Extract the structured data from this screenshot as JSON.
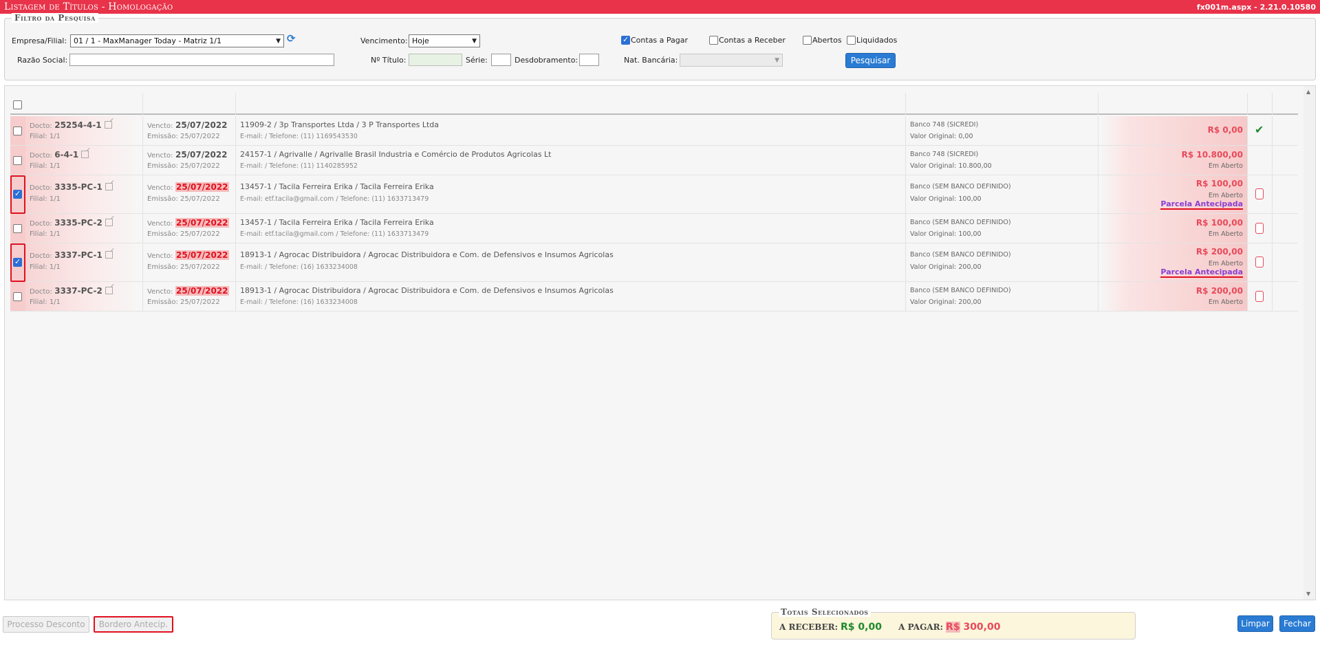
{
  "window": {
    "title": "Listagem de Títulos  - Homologação",
    "version": "fx001m.aspx - 2.21.0.10580"
  },
  "filter": {
    "legend": "Filtro da Pesquisa",
    "empresa_label": "Empresa/Filial:",
    "empresa_value": "01 / 1 - MaxManager Today - Matriz 1/1",
    "vencimento_label": "Vencimento:",
    "vencimento_value": "Hoje",
    "contas_pagar_label": "Contas a Pagar",
    "contas_pagar_checked": true,
    "contas_receber_label": "Contas a Receber",
    "abertos_label": "Abertos",
    "liquidados_label": "Liquidados",
    "razao_label": "Razão Social:",
    "titulo_label": "Nº Título:",
    "serie_label": "Série:",
    "desdobramento_label": "Desdobramento:",
    "nat_bancaria_label": "Nat. Bancária:",
    "search_button": "Pesquisar"
  },
  "rows": [
    {
      "selected": false,
      "docto_key": "Docto:",
      "docto": "25254-4-1",
      "filial": "Filial: 1/1",
      "vencto_key": "Vencto:",
      "vencto": "25/07/2022",
      "vencto_late": false,
      "emissao": "Emissão: 25/07/2022",
      "pessoa": "11909-2 / 3p Transportes Ltda / 3 P Transportes Ltda",
      "contato": "E-mail: / Telefone: (11) 1169543530",
      "banco": "Banco 748 (SICREDI)",
      "valor_original": "Valor Original: 0,00",
      "valor": "R$ 0,00",
      "status": "",
      "link": "",
      "action": "check-icon"
    },
    {
      "selected": false,
      "docto_key": "Docto:",
      "docto": "6-4-1",
      "filial": "Filial: 1/1",
      "vencto_key": "Vencto:",
      "vencto": "25/07/2022",
      "vencto_late": false,
      "emissao": "Emissão: 25/07/2022",
      "pessoa": "24157-1 / Agrivalle / Agrivalle Brasil Industria e Comércio de Produtos Agricolas Lt",
      "contato": "E-mail: / Telefone: (11) 1140285952",
      "banco": "Banco 748 (SICREDI)",
      "valor_original": "Valor Original: 10.800,00",
      "valor": "R$ 10.800,00",
      "status": "Em Aberto",
      "link": "",
      "action": ""
    },
    {
      "selected": true,
      "docto_key": "Docto:",
      "docto": "3335-PC-1",
      "filial": "Filial: 1/1",
      "vencto_key": "Vencto:",
      "vencto": "25/07/2022",
      "vencto_late": true,
      "emissao": "Emissão: 25/07/2022",
      "pessoa": "13457-1 / Tacila Ferreira Erika / Tacila Ferreira Erika",
      "contato": "E-mail: etf.tacila@gmail.com / Telefone: (11) 1633713479",
      "banco": "Banco (SEM BANCO DEFINIDO)",
      "valor_original": "Valor Original: 100,00",
      "valor": "R$ 100,00",
      "status": "Em Aberto",
      "link": "Parcela Antecipada",
      "action": "trash-icon"
    },
    {
      "selected": false,
      "docto_key": "Docto:",
      "docto": "3335-PC-2",
      "filial": "Filial: 1/1",
      "vencto_key": "Vencto:",
      "vencto": "25/07/2022",
      "vencto_late": true,
      "emissao": "Emissão: 25/07/2022",
      "pessoa": "13457-1 / Tacila Ferreira Erika / Tacila Ferreira Erika",
      "contato": "E-mail: etf.tacila@gmail.com / Telefone: (11) 1633713479",
      "banco": "Banco (SEM BANCO DEFINIDO)",
      "valor_original": "Valor Original: 100,00",
      "valor": "R$ 100,00",
      "status": "Em Aberto",
      "link": "",
      "action": "trash-icon"
    },
    {
      "selected": true,
      "docto_key": "Docto:",
      "docto": "3337-PC-1",
      "filial": "Filial: 1/1",
      "vencto_key": "Vencto:",
      "vencto": "25/07/2022",
      "vencto_late": true,
      "emissao": "Emissão: 25/07/2022",
      "pessoa": "18913-1 / Agrocac Distribuidora / Agrocac Distribuidora e Com. de Defensivos e Insumos Agricolas",
      "contato": "E-mail: / Telefone: (16) 1633234008",
      "banco": "Banco (SEM BANCO DEFINIDO)",
      "valor_original": "Valor Original: 200,00",
      "valor": "R$ 200,00",
      "status": "Em Aberto",
      "link": "Parcela Antecipada",
      "action": "trash-icon"
    },
    {
      "selected": false,
      "docto_key": "Docto:",
      "docto": "3337-PC-2",
      "filial": "Filial: 1/1",
      "vencto_key": "Vencto:",
      "vencto": "25/07/2022",
      "vencto_late": true,
      "emissao": "Emissão: 25/07/2022",
      "pessoa": "18913-1 / Agrocac Distribuidora / Agrocac Distribuidora e Com. de Defensivos e Insumos Agricolas",
      "contato": "E-mail: / Telefone: (16) 1633234008",
      "banco": "Banco (SEM BANCO DEFINIDO)",
      "valor_original": "Valor Original: 200,00",
      "valor": "R$ 200,00",
      "status": "Em Aberto",
      "link": "",
      "action": "trash-icon"
    }
  ],
  "footer": {
    "processo_desconto": "Processo Desconto",
    "bordero_antecip": "Bordero Antecip.",
    "totals_legend": "Totais Selecionados",
    "a_receber_label": "A RECEBER:",
    "a_receber_value": "R$ 0,00",
    "a_pagar_label": "A PAGAR:",
    "a_pagar_currency": "R$",
    "a_pagar_amount": "300,00",
    "limpar": "Limpar",
    "fechar": "Fechar"
  },
  "colors": {
    "brand": "#e8334a",
    "accent": "#2a7bd3",
    "positive": "#1f8a2d",
    "negative": "#e84a5a",
    "link": "#8a3fd1"
  }
}
